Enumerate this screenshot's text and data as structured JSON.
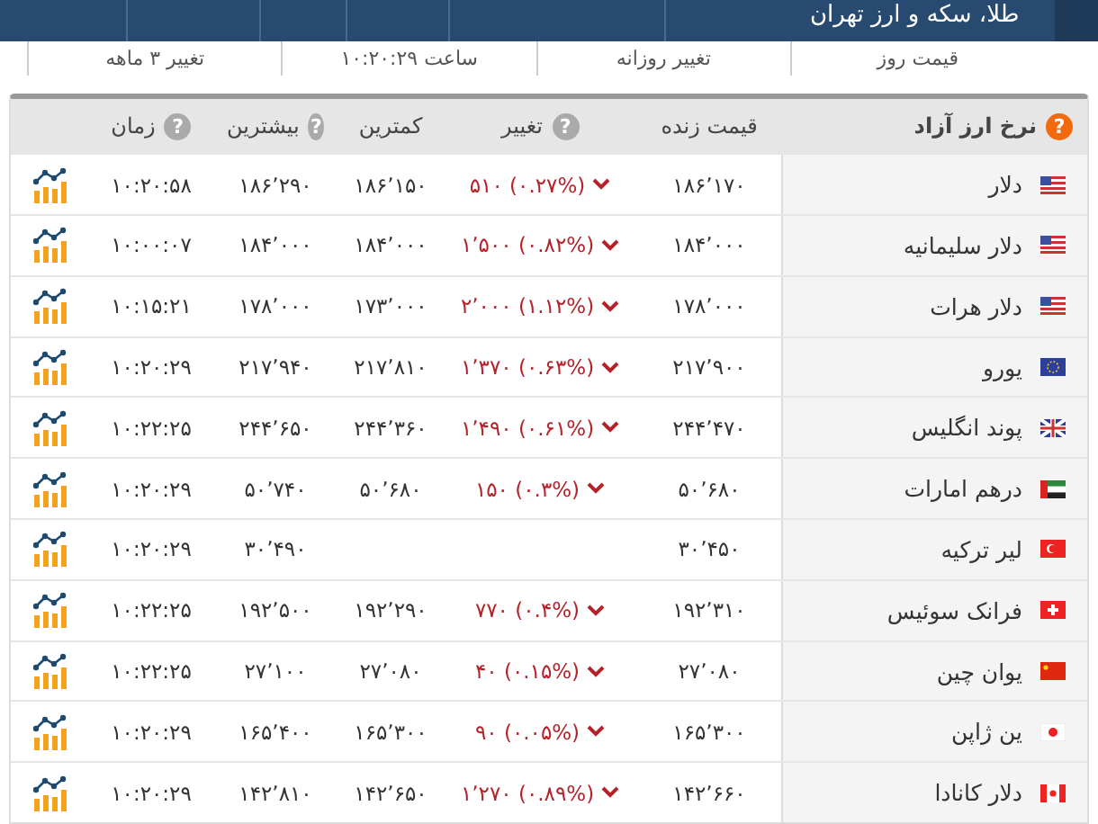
{
  "top_bar": {
    "title": "طلا، سکه و ارز تهران"
  },
  "sub_header": [
    "قیمت روز",
    "تغییر روزانه",
    "ساعت ۱۰:۲۰:۲۹",
    "تغییر ۳ ماهه"
  ],
  "table": {
    "columns": [
      {
        "label": "نرخ ارز آزاد",
        "kind": "title",
        "help": "?"
      },
      {
        "label": "قیمت زنده",
        "kind": "plain"
      },
      {
        "label": "تغییر",
        "kind": "help",
        "help": "?"
      },
      {
        "label": "کمترین",
        "kind": "plain"
      },
      {
        "label": "بیشترین",
        "kind": "help",
        "help": "?"
      },
      {
        "label": "زمان",
        "kind": "help",
        "help": "?"
      }
    ],
    "rows": [
      {
        "name": "دلار",
        "kind": "us",
        "price": "۱۸۶٬۱۷۰",
        "falling": true,
        "change": "۵۱۰ (۰.۲۷%)",
        "low": "۱۸۶٬۱۵۰",
        "high": "۱۸۶٬۲۹۰",
        "time": "۱۰:۲۰:۵۸"
      },
      {
        "name": "دلار سلیمانیه",
        "kind": "us",
        "price": "۱۸۴٬۰۰۰",
        "falling": true,
        "change": "۱٬۵۰۰ (۰.۸۲%)",
        "low": "۱۸۴٬۰۰۰",
        "high": "۱۸۴٬۰۰۰",
        "time": "۱۰:۰۰:۰۷"
      },
      {
        "name": "دلار هرات",
        "kind": "us",
        "price": "۱۷۸٬۰۰۰",
        "falling": true,
        "change": "۲٬۰۰۰ (۱.۱۲%)",
        "low": "۱۷۳٬۰۰۰",
        "high": "۱۷۸٬۰۰۰",
        "time": "۱۰:۱۵:۲۱"
      },
      {
        "name": "یورو",
        "kind": "eu",
        "price": "۲۱۷٬۹۰۰",
        "falling": true,
        "change": "۱٬۳۷۰ (۰.۶۳%)",
        "low": "۲۱۷٬۸۱۰",
        "high": "۲۱۷٬۹۴۰",
        "time": "۱۰:۲۰:۲۹"
      },
      {
        "name": "پوند انگلیس",
        "kind": "uk",
        "price": "۲۴۴٬۴۷۰",
        "falling": true,
        "change": "۱٬۴۹۰ (۰.۶۱%)",
        "low": "۲۴۴٬۳۶۰",
        "high": "۲۴۴٬۶۵۰",
        "time": "۱۰:۲۲:۲۵"
      },
      {
        "name": "درهم امارات",
        "kind": "ae",
        "price": "۵۰٬۶۸۰",
        "falling": true,
        "change": "۱۵۰ (۰.۳%)",
        "low": "۵۰٬۶۸۰",
        "high": "۵۰٬۷۴۰",
        "time": "۱۰:۲۰:۲۹"
      },
      {
        "name": "لیر ترکیه",
        "kind": "tr",
        "price": "۳۰٬۴۵۰",
        "high": "۳۰٬۴۹۰",
        "time": "۱۰:۲۰:۲۹"
      },
      {
        "name": "فرانک سوئیس",
        "kind": "ch",
        "price": "۱۹۲٬۳۱۰",
        "falling": true,
        "change": "۷۷۰ (۰.۴%)",
        "low": "۱۹۲٬۲۹۰",
        "high": "۱۹۲٬۵۰۰",
        "time": "۱۰:۲۲:۲۵"
      },
      {
        "name": "یوان چین",
        "kind": "cn",
        "price": "۲۷٬۰۸۰",
        "falling": true,
        "change": "۴۰ (۰.۱۵%)",
        "low": "۲۷٬۰۸۰",
        "high": "۲۷٬۱۰۰",
        "time": "۱۰:۲۲:۲۵"
      },
      {
        "name": "ین ژاپن",
        "kind": "jp",
        "price": "۱۶۵٬۳۰۰",
        "falling": true,
        "change": "۹۰ (۰.۰۵%)",
        "low": "۱۶۵٬۳۰۰",
        "high": "۱۶۵٬۴۰۰",
        "time": "۱۰:۲۰:۲۹"
      },
      {
        "name": "دلار کانادا",
        "kind": "ca",
        "price": "۱۴۲٬۶۶۰",
        "falling": true,
        "change": "۱٬۲۷۰ (۰.۸۹%)",
        "low": "۱۴۲٬۶۵۰",
        "high": "۱۴۲٬۸۱۰",
        "time": "۱۰:۲۰:۲۹"
      }
    ]
  }
}
